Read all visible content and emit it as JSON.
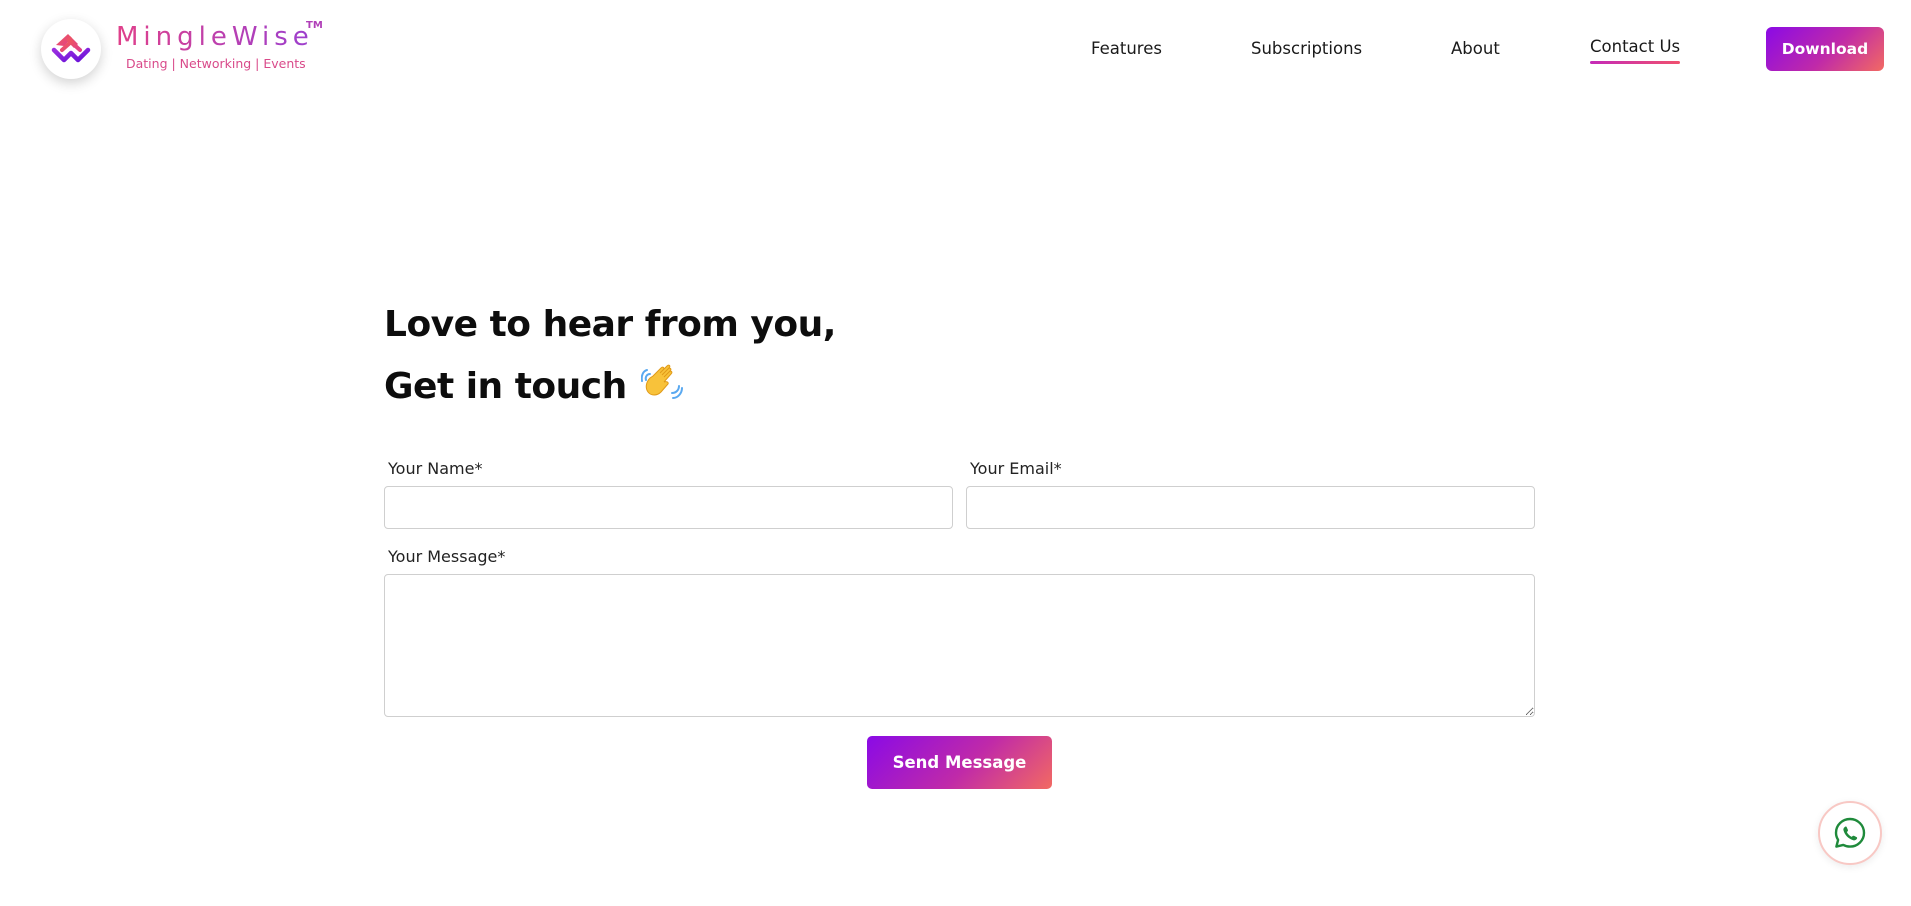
{
  "brand": {
    "name": "MingleWise",
    "trademark": "TM",
    "tagline": "Dating | Networking | Events"
  },
  "nav": {
    "items": [
      {
        "label": "Features",
        "active": false
      },
      {
        "label": "Subscriptions",
        "active": false
      },
      {
        "label": "About",
        "active": false
      },
      {
        "label": "Contact Us",
        "active": true
      }
    ],
    "download_label": "Download"
  },
  "hero": {
    "line1": "Love to hear from you,",
    "line2": "Get in touch",
    "emoji": "waving-hand-icon"
  },
  "form": {
    "name_label": "Your Name*",
    "email_label": "Your Email*",
    "message_label": "Your Message*",
    "name_value": "",
    "email_value": "",
    "message_value": "",
    "submit_label": "Send Message"
  },
  "floating": {
    "icon": "whatsapp-icon"
  },
  "colors": {
    "gradient_start": "#8a0ae6",
    "gradient_mid": "#c02aa8",
    "gradient_end": "#f26a62",
    "brand_pink": "#d63d8e",
    "whatsapp_green": "#1f8a3b"
  }
}
